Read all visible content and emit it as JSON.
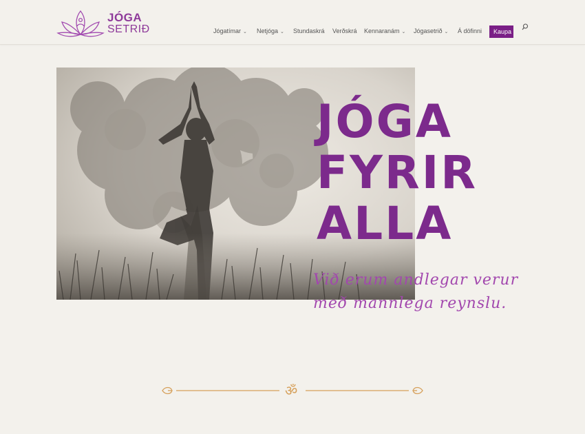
{
  "logo": {
    "line1": "JÓGA",
    "line2": "SETRIÐ"
  },
  "nav": {
    "items": [
      {
        "label": "Jógatímar",
        "dropdown": true
      },
      {
        "label": "Netjóga",
        "dropdown": true
      },
      {
        "label": "Stundaskrá",
        "dropdown": false
      },
      {
        "label": "Verðskrá",
        "dropdown": false
      },
      {
        "label": "Kennaranám",
        "dropdown": true
      },
      {
        "label": "Jógasetrið",
        "dropdown": true
      },
      {
        "label": "Á döfinni",
        "dropdown": false
      }
    ],
    "buy_label": "Kaupa",
    "search_icon": "search-icon"
  },
  "hero": {
    "title_lines": [
      "JÓGA",
      "FYRIR",
      "ALLA"
    ],
    "subtitle_lines": [
      "Við erum andlegar verur",
      "með mannlega reynslu."
    ]
  },
  "divider": {
    "symbol": "ॐ"
  },
  "colors": {
    "accent": "#7c2a8c",
    "button": "#7a1f86",
    "divider": "#d6a05a",
    "background": "#f3f1ec"
  }
}
